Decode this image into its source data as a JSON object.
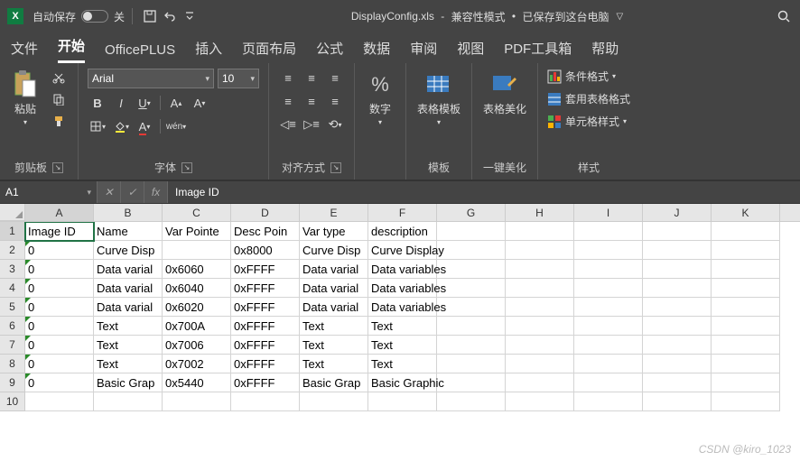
{
  "title": {
    "autosave": "自动保存",
    "autosave_state": "关",
    "filename": "DisplayConfig.xls",
    "mode": "兼容性模式",
    "saved": "已保存到这台电脑"
  },
  "tabs": {
    "file": "文件",
    "home": "开始",
    "officeplus": "OfficePLUS",
    "insert": "插入",
    "layout": "页面布局",
    "formula": "公式",
    "data": "数据",
    "review": "审阅",
    "view": "视图",
    "pdf": "PDF工具箱",
    "help": "帮助"
  },
  "ribbon": {
    "clipboard": {
      "paste": "粘贴",
      "label": "剪贴板"
    },
    "font": {
      "name": "Arial",
      "size": "10",
      "label": "字体"
    },
    "align": {
      "label": "对齐方式"
    },
    "number": {
      "btn": "数字",
      "label": ""
    },
    "template": {
      "btn": "表格模板",
      "label": "模板"
    },
    "beautify": {
      "btn": "表格美化",
      "label": "一键美化"
    },
    "styles": {
      "cond": "条件格式",
      "tablefmt": "套用表格格式",
      "cellstyle": "单元格样式",
      "label": "样式"
    }
  },
  "formula_bar": {
    "namebox": "A1",
    "content": "Image ID"
  },
  "columns": [
    "A",
    "B",
    "C",
    "D",
    "E",
    "F",
    "G",
    "H",
    "I",
    "J",
    "K"
  ],
  "rows": [
    {
      "n": "1",
      "c": [
        "Image ID",
        "Name",
        "Var Pointe",
        "Desc Poin",
        "Var type",
        "description",
        "",
        "",
        "",
        "",
        ""
      ]
    },
    {
      "n": "2",
      "c": [
        "0",
        "Curve Disp",
        "",
        "0x8000",
        "Curve Disp",
        "Curve Display",
        "",
        "",
        "",
        "",
        ""
      ]
    },
    {
      "n": "3",
      "c": [
        "0",
        "Data varial",
        "0x6060",
        "0xFFFF",
        "Data varial",
        "Data variables",
        "",
        "",
        "",
        "",
        ""
      ]
    },
    {
      "n": "4",
      "c": [
        "0",
        "Data varial",
        "0x6040",
        "0xFFFF",
        "Data varial",
        "Data variables",
        "",
        "",
        "",
        "",
        ""
      ]
    },
    {
      "n": "5",
      "c": [
        "0",
        "Data varial",
        "0x6020",
        "0xFFFF",
        "Data varial",
        "Data variables",
        "",
        "",
        "",
        "",
        ""
      ]
    },
    {
      "n": "6",
      "c": [
        "0",
        "Text",
        "0x700A",
        "0xFFFF",
        "Text",
        "Text",
        "",
        "",
        "",
        "",
        ""
      ]
    },
    {
      "n": "7",
      "c": [
        "0",
        "Text",
        "0x7006",
        "0xFFFF",
        "Text",
        "Text",
        "",
        "",
        "",
        "",
        ""
      ]
    },
    {
      "n": "8",
      "c": [
        "0",
        "Text",
        "0x7002",
        "0xFFFF",
        "Text",
        "Text",
        "",
        "",
        "",
        "",
        ""
      ]
    },
    {
      "n": "9",
      "c": [
        "0",
        "Basic Grap",
        "0x5440",
        "0xFFFF",
        "Basic Grap",
        "Basic Graphic",
        "",
        "",
        "",
        "",
        ""
      ]
    },
    {
      "n": "10",
      "c": [
        "",
        "",
        "",
        "",
        "",
        "",
        "",
        "",
        "",
        "",
        ""
      ]
    }
  ],
  "watermark": "CSDN @kiro_1023"
}
